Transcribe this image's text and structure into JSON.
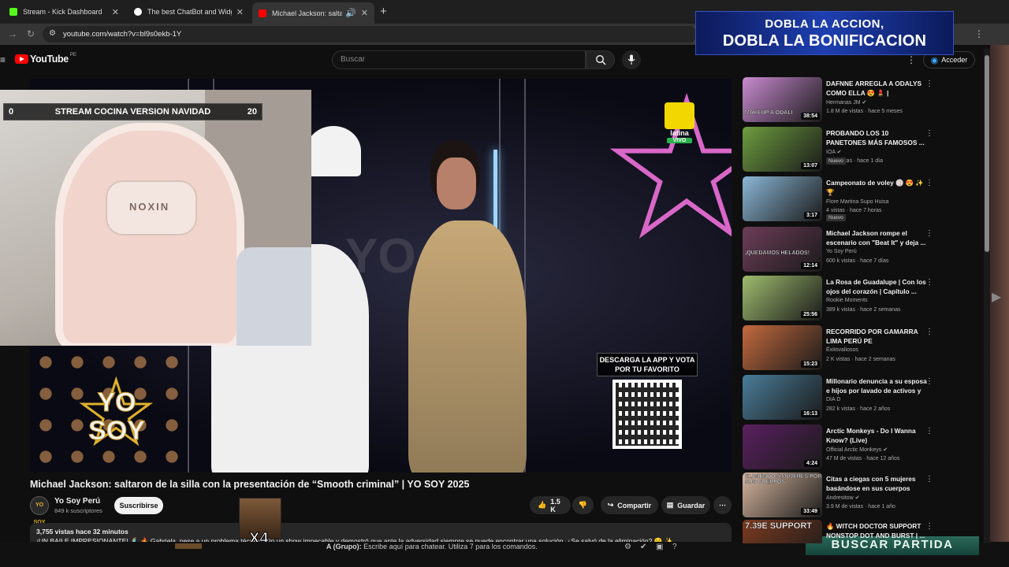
{
  "browser": {
    "tabs": [
      {
        "label": "Stream - Kick Dashboard",
        "color": "#53fc18"
      },
      {
        "label": "The best ChatBot and Widgets",
        "color": "#ffffff"
      },
      {
        "label": "Michael Jackson: saltaron d",
        "color": "#ff0000"
      }
    ],
    "url": "youtube.com/watch?v=bl9s0ekb-1Y"
  },
  "masthead": {
    "logo_text": "YouTube",
    "country": "PE",
    "search_placeholder": "Buscar",
    "signin_label": "Acceder"
  },
  "promo": {
    "line1": "DOBLA LA ACCION,",
    "line2": "DOBLA LA BONIFICACION"
  },
  "overlay": {
    "progress_label": "STREAM COCINA VERSION NAVIDAD",
    "progress_min": "0",
    "progress_max": "20",
    "progress_value": 0,
    "chair_brand": "NOXIN",
    "meme_badge": "X4"
  },
  "player": {
    "channel_bug": "latina",
    "live_badge": "VIVO",
    "show_logo_line1": "YO",
    "show_logo_line2": "SOY",
    "app_promo": "DESCARGA LA APP Y VOTA POR TU FAVORITO",
    "stage_letters": "YO"
  },
  "video": {
    "title": "Michael Jackson: saltaron de la silla con la presentación de “Smooth criminal” | YO SOY 2025",
    "channel": "Yo Soy Perú",
    "channel_avatar": "YO SOY",
    "subscribers": "849 k suscriptores",
    "subscribe_label": "Suscribirse",
    "likes": "1.5 K",
    "share_label": "Compartir",
    "save_label": "Guardar",
    "views_time": "3,755 vistas  hace 32 minutos",
    "description": "¡UN BAILE IMPRESIONANTE! 🕺 🔥 Gabriela, pese a un problema técnico, dio un show impecable y demostró que ante la adversidad siempre se puede encontrar una solución. ¿Se salvó de la eliminación? 😮 ✨"
  },
  "game_overlay": {
    "chat_prefix": "A (Grupo):",
    "chat_hint": "Escribe aquí para chatear. Utiliza 7 para los comandos.",
    "button": "BUSCAR PARTIDA"
  },
  "recommendations": [
    {
      "title": "DAFNNE ARREGLA A ODALYS COMO ELLA 😍 💄 | Hermanas...",
      "channel": "Hermanas JM ✔",
      "meta": "1.8 M de vistas · hace 5 meses",
      "duration": "38:54",
      "thumb": "#c98bd0",
      "caption": "MAKEUP A ODALI",
      "nuevo": ""
    },
    {
      "title": "PROBANDO LOS 10 PANETONES MÁS FAMOSOS ...",
      "channel": "IOA ✔",
      "meta": "63 k vistas · hace 1 día",
      "duration": "13:07",
      "thumb": "#6e9d3f",
      "caption": "",
      "nuevo": "Nuevo"
    },
    {
      "title": "Campeonato de voley 🏐 😍 ✨ 🏆",
      "channel": "Flore Martina Supo Huisa",
      "meta": "4 vistas · hace 7 horas",
      "duration": "3:17",
      "thumb": "#8bb7d6",
      "caption": "",
      "nuevo": "Nuevo"
    },
    {
      "title": "Michael Jackson rompe el escenario con \"Beat It\" y deja ...",
      "channel": "Yo Soy Perú",
      "meta": "600 k vistas · hace 7 días",
      "duration": "12:14",
      "thumb": "#6d3d58",
      "caption": "¡QUEDAMOS HELADOS!",
      "nuevo": ""
    },
    {
      "title": "La Rosa de Guadalupe | Con los ojos del corazón | Capítulo ...",
      "channel": "Rookie Moments",
      "meta": "389 k vistas · hace 2 semanas",
      "duration": "25:56",
      "thumb": "#9fbc6e",
      "caption": "",
      "nuevo": ""
    },
    {
      "title": "RECORRIDO POR GAMARRA LIMA PERÚ PE",
      "channel": "Éxitovaliosos",
      "meta": "2 K vistas · hace 2 semanas",
      "duration": "15:23",
      "thumb": "#c46a3e",
      "caption": "",
      "nuevo": ""
    },
    {
      "title": "Millonario denuncia a su esposa e hijos por lavado de activos y ...",
      "channel": "DIA D",
      "meta": "282 k vistas · hace 2 años",
      "duration": "16:13",
      "thumb": "#4a7d9a",
      "caption": "",
      "nuevo": ""
    },
    {
      "title": "Arctic Monkeys - Do I Wanna Know? (Live)",
      "channel": "Official Arctic Monkeys ✔",
      "meta": "47 M de vistas · hace 12 años",
      "duration": "4:24",
      "thumb": "#5a2060",
      "caption": "",
      "nuevo": ""
    },
    {
      "title": "Citas a ciegas con 5 mujeres basándose en sus cuerpos",
      "channel": "Andresitow ✔",
      "meta": "3.9 M de vistas · hace 1 año",
      "duration": "33:49",
      "thumb": "#d8b7a0",
      "caption": "ELIGIENDO 5 MUJERES POR SUS CUERPOS",
      "nuevo": ""
    },
    {
      "title": "🔥 WITCH DOCTOR SUPPORT NONSTOP DOT AND BURST | ...",
      "channel": "",
      "meta": "",
      "duration": "",
      "thumb": "#7a3a20",
      "caption": "7.39E SUPPORT",
      "nuevo": ""
    }
  ]
}
